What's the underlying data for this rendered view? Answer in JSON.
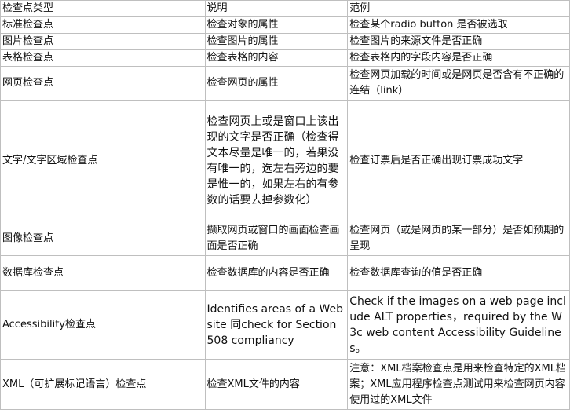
{
  "headers": [
    "检查点类型",
    "说明",
    "范例"
  ],
  "rows": [
    [
      "标准检查点",
      "检查对象的属性",
      "检查某个radio button 是否被选取"
    ],
    [
      "图片检查点",
      "检查图片的属性",
      "检查图片的来源文件是否正确"
    ],
    [
      "表格检查点",
      "检查表格的内容",
      "检查表格内的字段内容是否正确"
    ],
    [
      "网页检查点",
      "检查网页的属性",
      "检查网页加载的时间或是网页是否含有不正确的连结（link）"
    ],
    [
      "文字/文字区域检查点",
      "检查网页上或是窗口上该出现的文字是否正确（检查得文本尽量是唯一的，若果没有唯一的，选左右旁边的要是惟一的，如果左右的有参数的话要去掉参数化）",
      "检查订票后是否正确出现订票成功文字"
    ],
    [
      "图像检查点",
      "撷取网页或窗口的画面检查画面是否正确",
      "检查网页（或是网页的某一部分）是否如预期的呈现"
    ],
    [
      "数据库检查点",
      "检查数据库的内容是否正确",
      "检查数据库查询的值是否正确"
    ],
    [
      "Accessibility检查点",
      "Identifies areas of a Web site 同check for Section 508 compliancy",
      "Check if the images on a web page include ALT properties，required by the W3c web content Accessibility Guidelines。"
    ],
    [
      "XML（可扩展标记语言）检查点",
      "检查XML文件的内容",
      "注意：XML档案检查点是用来检查特定的XML档案；XML应用程序检查点测试用来检查网页内容使用过的XML文件"
    ]
  ]
}
